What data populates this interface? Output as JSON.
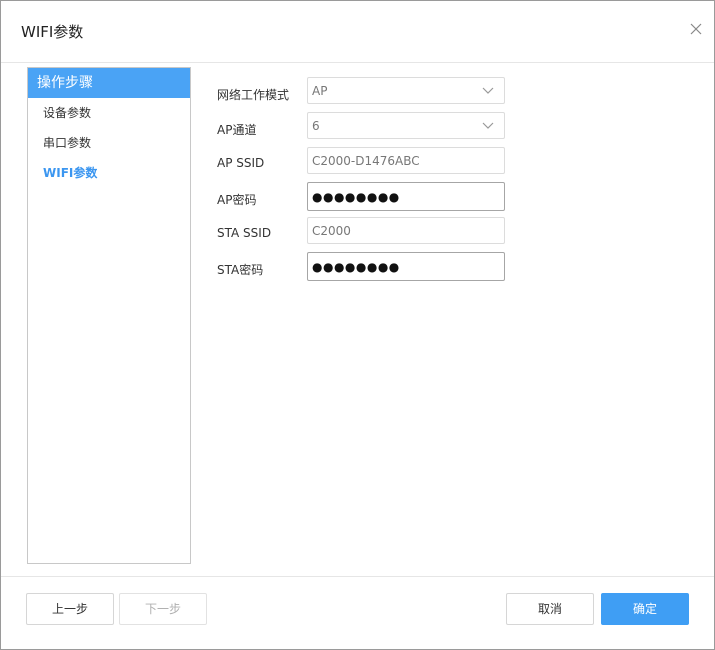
{
  "dialog": {
    "title": "WIFI参数"
  },
  "steps": {
    "header": "操作步骤",
    "items": [
      "设备参数",
      "串口参数",
      "WIFI参数"
    ],
    "active_index": 2
  },
  "form": {
    "fields": [
      {
        "label": "网络工作模式",
        "value": "AP",
        "type": "select"
      },
      {
        "label": "AP通道",
        "value": "6",
        "type": "select"
      },
      {
        "label": "AP SSID",
        "value": "C2000-D1476ABC",
        "type": "text"
      },
      {
        "label": "AP密码",
        "value": "●●●●●●●●",
        "type": "password"
      },
      {
        "label": "STA SSID",
        "value": "C2000",
        "type": "text"
      },
      {
        "label": "STA密码",
        "value": "●●●●●●●●",
        "type": "password"
      }
    ]
  },
  "footer": {
    "prev_label": "上一步",
    "next_label": "下一步",
    "cancel_label": "取消",
    "confirm_label": "确定"
  },
  "colors": {
    "accent": "#4aa3f5",
    "active_step_text": "#3b96f0",
    "primary_button": "#3f9ef4"
  },
  "icons": {
    "close": "close-icon",
    "dropdown": "chevron-down-icon"
  }
}
